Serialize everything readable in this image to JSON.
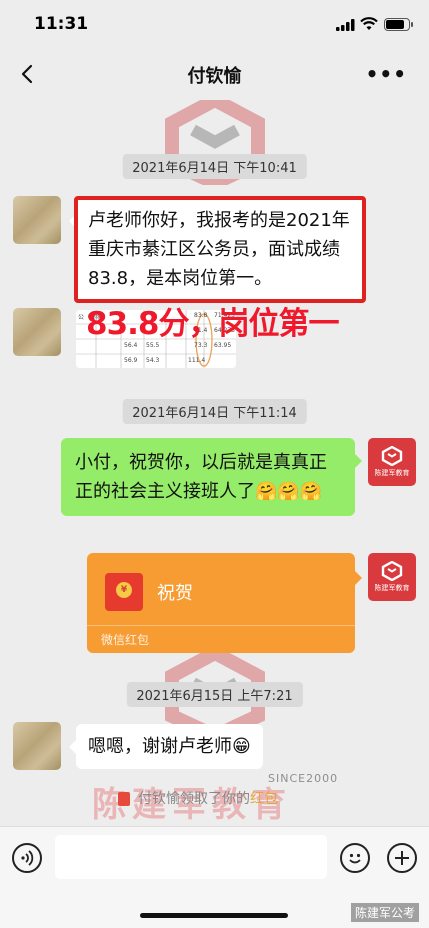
{
  "status": {
    "time": "11:31",
    "battery_level": 0.85
  },
  "nav": {
    "title": "付钦愉",
    "more": "•••"
  },
  "messages": {
    "stamp1": "2021年6月14日 下午10:41",
    "msg1": "卢老师你好，我报考的是2021年重庆市綦江区公务员，面试成绩83.8，是本岗位第一。",
    "overlay": "83.8分，岗位第一",
    "table": {
      "rows": [
        [
          "公（参照",
          "",
          "83.8",
          "71.425"
        ],
        [
          "",
          "",
          "71.4",
          "64.275"
        ],
        [
          "56.4",
          "55.5",
          "73.3",
          "63.95"
        ],
        [
          "56.9",
          "54.3",
          "111.4",
          ""
        ]
      ]
    },
    "stamp2": "2021年6月14日 下午11:14",
    "msg2": "小付，祝贺你，以后就是真真正正的社会主义接班人了🤗🤗🤗",
    "brand_avatar_text": "陈建军教育",
    "redpacket": {
      "title": "祝贺",
      "footer": "微信红包"
    },
    "stamp3": "2021年6月15日 上午7:21",
    "msg3": "嗯嗯，谢谢卢老师😁",
    "notice_prefix": "付钦愉领取了你的",
    "notice_highlight": "红包"
  },
  "watermarks": {
    "since": "SINCE2000",
    "brand": "陈建军教育",
    "corner": "陈建军公考"
  },
  "input": {
    "placeholder": ""
  },
  "colors": {
    "accent_red": "#e0211f",
    "green_bubble": "#95ec69",
    "redpacket": "#f79c32"
  }
}
